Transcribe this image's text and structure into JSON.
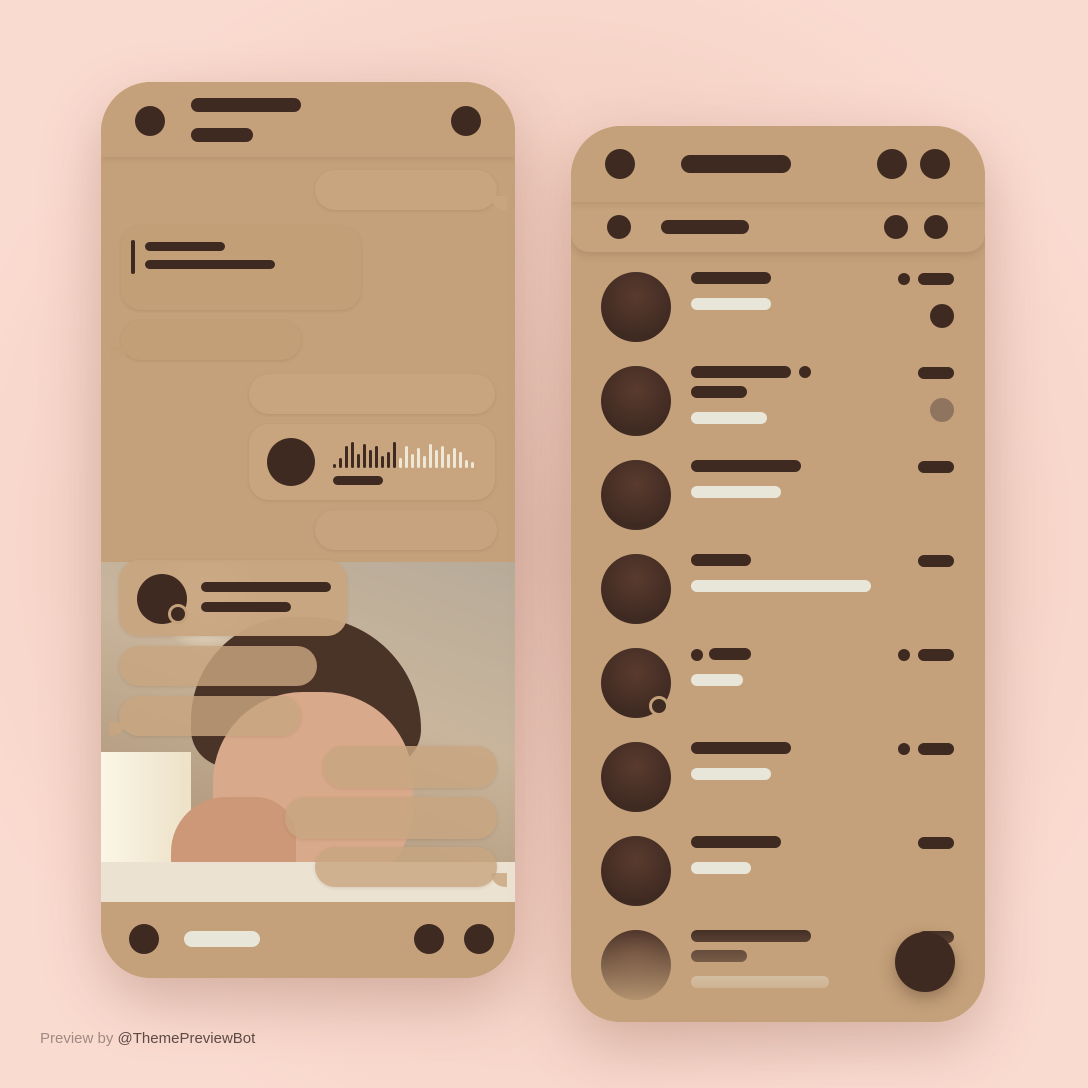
{
  "theme": {
    "accent_dark": "#3f2a22",
    "panel": "#c4a17a",
    "light_bar": "#e8e6d8",
    "background": "#f8d7cb"
  },
  "icons": {
    "chat_back": "back-icon",
    "chat_menu": "more-icon",
    "attach": "attach-icon",
    "emoji": "emoji-icon",
    "send": "send-icon",
    "list_menu": "menu-icon",
    "search": "search-icon",
    "lock": "lock-icon",
    "compose": "pencil-icon"
  },
  "chat": {
    "voice_message": {
      "playing_fraction": 0.45
    }
  },
  "chat_list": {
    "unread_badges": [
      true,
      false,
      false,
      false,
      false,
      false,
      false,
      false
    ],
    "muted_badges": [
      false,
      true,
      false,
      false,
      false,
      false,
      false,
      false
    ]
  },
  "footer": {
    "credit_prefix": "Preview by",
    "credit_handle": "@ThemePreviewBot"
  }
}
